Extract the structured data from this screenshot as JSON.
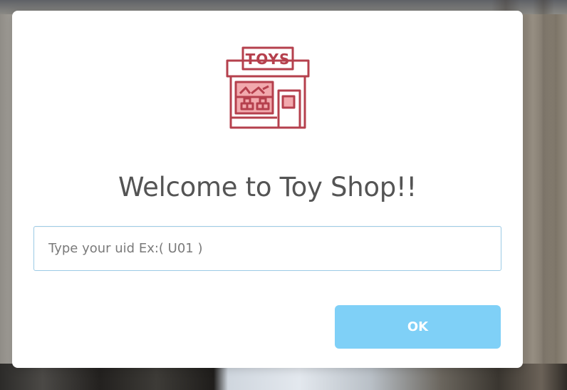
{
  "modal": {
    "title": "Welcome to Toy Shop!!",
    "logo_icon": "toy-shop-icon",
    "logo_sign_text": "TOYS",
    "input": {
      "value": "",
      "placeholder": "Type your uid Ex:( U01 )"
    },
    "ok_label": "OK"
  },
  "colors": {
    "logo_stroke": "#b5404d",
    "logo_fill": "#f2a9ad",
    "ok_button": "#7fd0f7",
    "input_border": "#9ccbe6",
    "title_text": "#545454"
  }
}
